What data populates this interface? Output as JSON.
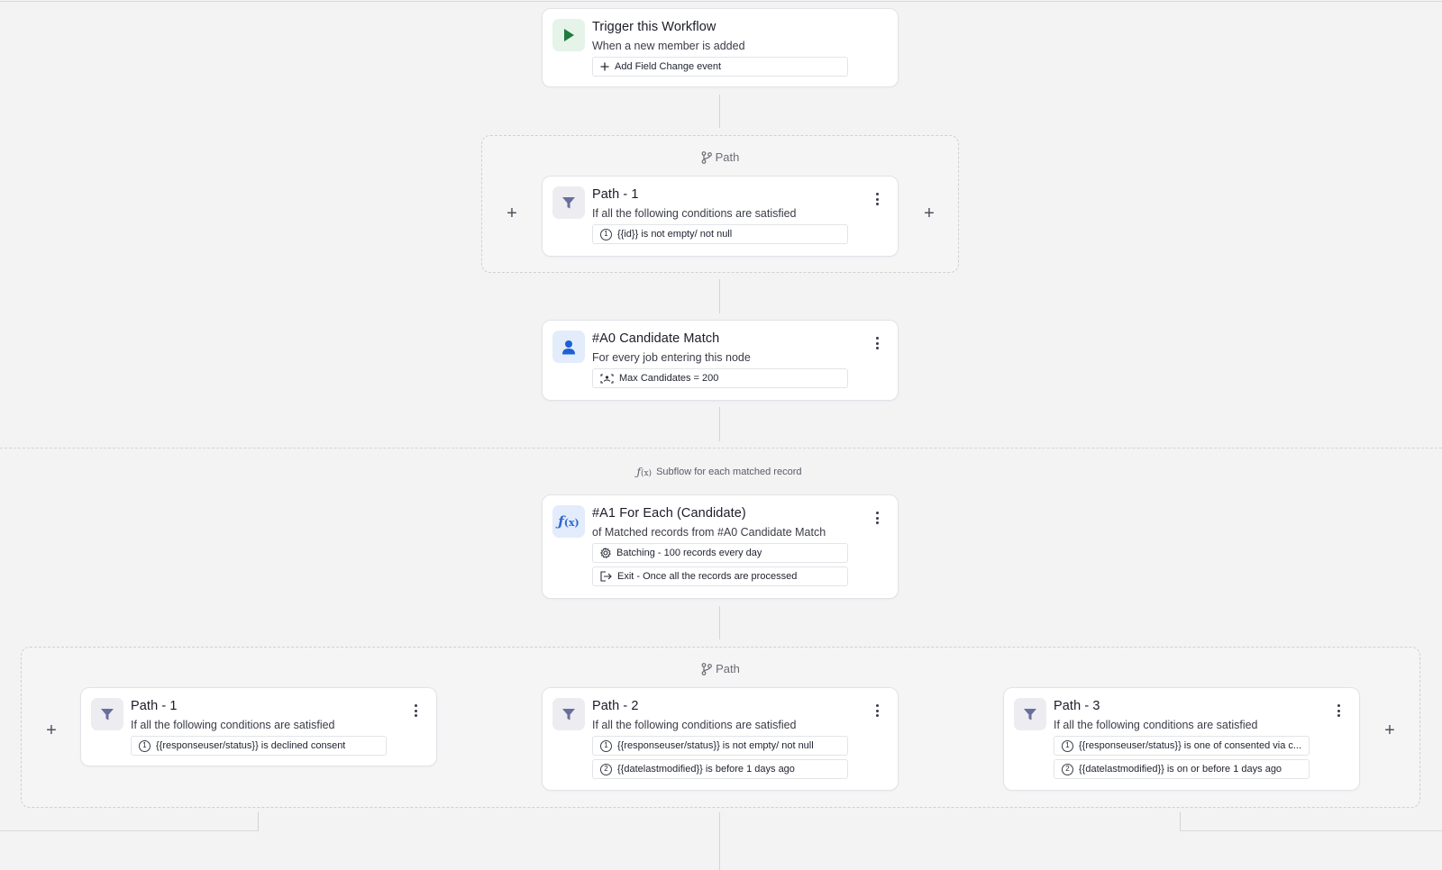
{
  "trigger": {
    "title": "Trigger this Workflow",
    "subtitle": "When a new member is added",
    "chip": "Add Field Change event"
  },
  "path_group_1": {
    "label": "Path",
    "card": {
      "title": "Path - 1",
      "subtitle": "If all the following conditions are satisfied",
      "conditions": [
        "{{id}} is not empty/ not null"
      ]
    }
  },
  "candidate_match": {
    "title": "#A0 Candidate Match",
    "subtitle": "For every job entering this node",
    "chip": "Max Candidates = 200"
  },
  "subflow": {
    "label": "Subflow for each matched record"
  },
  "for_each": {
    "title": "#A1 For Each (Candidate)",
    "subtitle": "of Matched records from #A0 Candidate Match",
    "chips": [
      "Batching - 100 records every day",
      "Exit - Once all the records are processed"
    ]
  },
  "path_group_2": {
    "label": "Path",
    "cards": [
      {
        "title": "Path - 1",
        "subtitle": "If all the following conditions are satisfied",
        "conditions": [
          "{{responseuser/status}} is declined consent"
        ]
      },
      {
        "title": "Path - 2",
        "subtitle": "If all the following conditions are satisfied",
        "conditions": [
          "{{responseuser/status}} is not empty/ not null",
          "{{datelastmodified}} is before 1 days ago"
        ]
      },
      {
        "title": "Path - 3",
        "subtitle": "If all the following conditions are satisfied",
        "conditions": [
          "{{responseuser/status}} is one of consented via c...",
          "{{datelastmodified}} is on or before 1 days ago"
        ]
      }
    ]
  },
  "condition_numbers": [
    "1",
    "2"
  ],
  "icons": {
    "trigger": "play-icon",
    "path": "filter-icon",
    "candidate": "person-icon",
    "for_each": "function-icon",
    "group": "branch-icon"
  },
  "colors": {
    "play": "#1e7a3c",
    "filter": "#6a6e9c",
    "person": "#1f5fd6",
    "function": "#2f66d0"
  }
}
